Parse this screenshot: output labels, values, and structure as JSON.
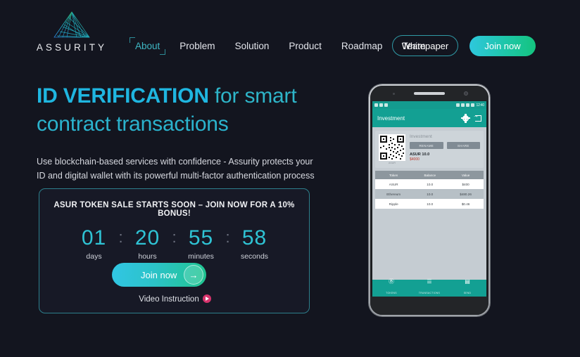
{
  "brand": {
    "name": "ASSURITY",
    "logo_icon": "triangle-mesh-logo"
  },
  "nav": {
    "items": [
      {
        "label": "About",
        "active": true
      },
      {
        "label": "Problem",
        "active": false
      },
      {
        "label": "Solution",
        "active": false
      },
      {
        "label": "Product",
        "active": false
      },
      {
        "label": "Roadmap",
        "active": false
      },
      {
        "label": "Team",
        "active": false
      }
    ],
    "whitepaper_label": "Whitepaper",
    "join_label": "Join now"
  },
  "hero": {
    "headline_strong": "ID VERIFICATION",
    "headline_light": " for smart",
    "headline_line2": "contract transactions",
    "subtitle": "Use blockchain-based services with confidence - Assurity protects your ID and digital wallet with its powerful multi-factor authentication process"
  },
  "countdown": {
    "title": "ASUR TOKEN SALE STARTS SOON – JOIN NOW FOR A 10% BONUS!",
    "separator": ":",
    "units": [
      {
        "value": "01",
        "label": "days"
      },
      {
        "value": "20",
        "label": "hours"
      },
      {
        "value": "55",
        "label": "minutes"
      },
      {
        "value": "58",
        "label": "seconds"
      }
    ],
    "cta_label": "Join now",
    "cta_arrow": "→",
    "video_label": "Video Instruction"
  },
  "phone": {
    "statusbar": {
      "time": "12:40",
      "left_icons": [
        "play-icon",
        "mail-icon",
        "camera-icon"
      ],
      "right_icons": [
        "bluetooth-icon",
        "wifi-icon",
        "signal-icon",
        "battery-icon"
      ]
    },
    "appbar": {
      "title": "Investment",
      "gear_icon": "gear-icon",
      "logout_icon": "logout-icon"
    },
    "card": {
      "qr_caption": "ASUR",
      "label": "Investment",
      "rename_label": "RENAME",
      "share_label": "SHARE",
      "amount": "ASUR 10.0",
      "fiat": "$4000"
    },
    "table": {
      "headers": [
        "Token",
        "Balance",
        "Value"
      ],
      "rows": [
        {
          "token": "ASUR",
          "balance": "10.0",
          "value": "$400"
        },
        {
          "token": "Ethereum",
          "balance": "10.0",
          "value": "$480.26"
        },
        {
          "token": "Ripple",
          "balance": "10.0",
          "value": "$0.46"
        }
      ]
    },
    "tabs": [
      {
        "icon": "Ⓑ",
        "label": "TOKENS",
        "icon_name": "token-icon"
      },
      {
        "icon": "☰",
        "label": "TRANSACTIONS",
        "icon_name": "list-icon"
      },
      {
        "icon": "▤",
        "label": "SEND",
        "icon_name": "send-icon"
      }
    ]
  },
  "colors": {
    "background": "#13151f",
    "accent_cyan": "#2fc3d4",
    "accent_green": "#14c47f",
    "app_teal": "#13a093",
    "alert_red": "#c0392b",
    "play_pink": "#d6336c"
  }
}
